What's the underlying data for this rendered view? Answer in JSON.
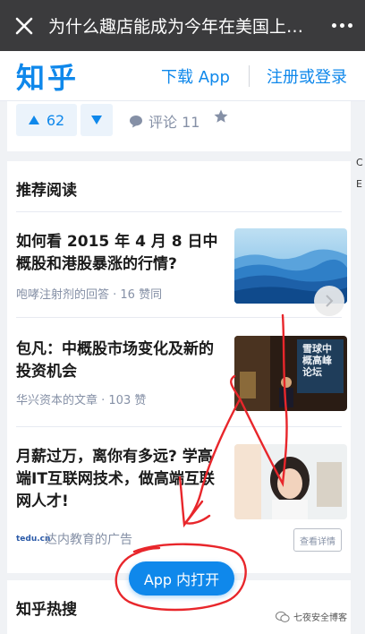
{
  "topbar": {
    "title": "为什么趣店能成为今年在美国上市的"
  },
  "header": {
    "logo": "知乎",
    "download_label": "下载 App",
    "login_label": "注册或登录"
  },
  "actions": {
    "upvote_count": "62",
    "comment_label": "评论 11"
  },
  "recommend": {
    "title": "推荐阅读",
    "items": [
      {
        "title": "如何看 2015 年 4 月 8 日中概股和港股暴涨的行情?",
        "meta": "咆哮注射剂的回答 · 16 赞同"
      },
      {
        "title": "包凡：中概股市场变化及新的投资机会",
        "meta": "华兴资本的文章 · 103 赞",
        "thumb_caption": "雪球中概高峰论坛"
      },
      {
        "title": "月薪过万，离你有多远? 学高端IT互联网技术，做高端互联网人才!",
        "meta": "达内教育的广告",
        "ad_logo_text": "tedu.cn",
        "ad_button": "查看详情"
      }
    ]
  },
  "hot": {
    "title": "知乎热搜"
  },
  "open_app_label": "App 内打开",
  "edge_chars": [
    "C",
    "E"
  ],
  "watermark": "七夜安全博客",
  "colors": {
    "brand": "#0f88eb",
    "topbar": "#3b3b3d",
    "annotation": "#e8262b"
  }
}
